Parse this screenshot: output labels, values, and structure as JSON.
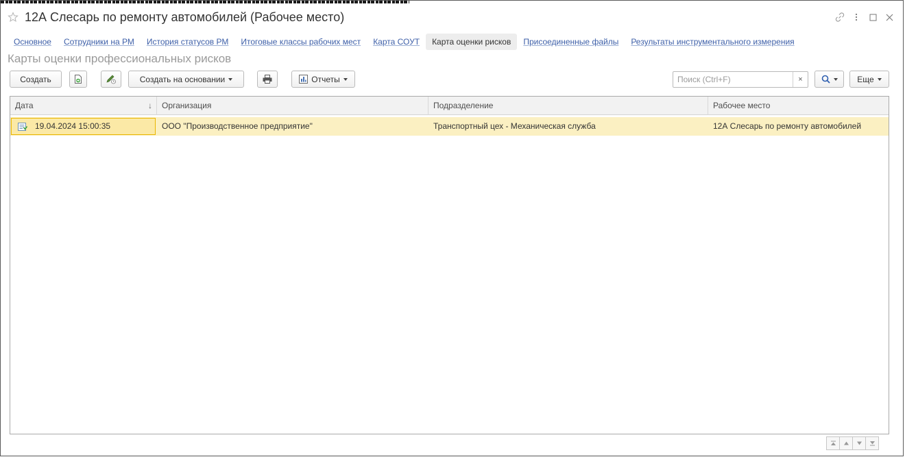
{
  "window": {
    "title": "12А Слесарь по ремонту автомобилей (Рабочее место)"
  },
  "tabs": [
    {
      "label": "Основное",
      "active": false
    },
    {
      "label": "Сотрудники на РМ",
      "active": false
    },
    {
      "label": "История статусов РМ",
      "active": false
    },
    {
      "label": "Итоговые классы рабочих мест",
      "active": false
    },
    {
      "label": "Карта СОУТ",
      "active": false
    },
    {
      "label": "Карта оценки рисков",
      "active": true
    },
    {
      "label": "Присоединенные файлы",
      "active": false
    },
    {
      "label": "Результаты инструментального измерения",
      "active": false
    }
  ],
  "section_title": "Карты оценки профессиональных рисков",
  "toolbar": {
    "create_label": "Создать",
    "create_based_label": "Создать на основании",
    "reports_label": "Отчеты",
    "search_placeholder": "Поиск (Ctrl+F)",
    "search_clear": "×",
    "more_label": "Еще"
  },
  "table": {
    "columns": [
      "Дата",
      "Организация",
      "Подразделение",
      "Рабочее место"
    ],
    "rows": [
      {
        "date": "19.04.2024 15:00:35",
        "organization": "ООО \"Производственное предприятие\"",
        "department": "Транспортный цех - Механическая служба",
        "workplace": "12А Слесарь по ремонту автомобилей"
      }
    ]
  },
  "colors": {
    "link": "#3d5fa8",
    "selected_row": "#fbf0c2",
    "selected_cell_border": "#e9b600"
  }
}
